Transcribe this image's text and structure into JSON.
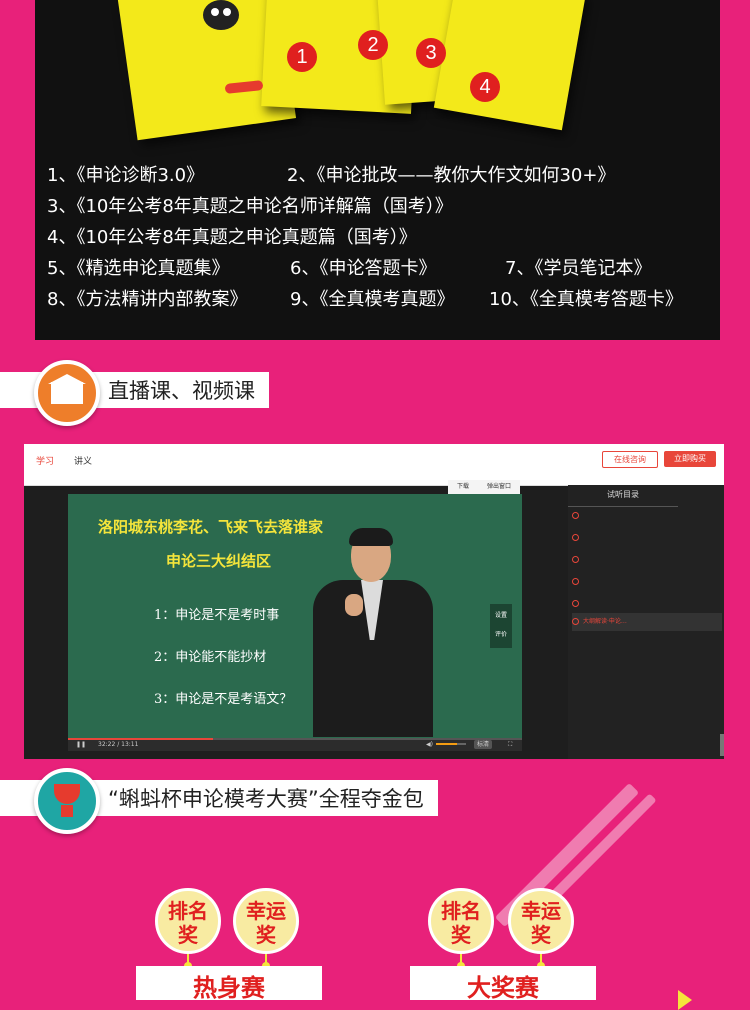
{
  "books": {
    "badges": [
      "1",
      "2",
      "3",
      "4"
    ],
    "lines": [
      [
        "1、《申论诊断3.0》",
        "2、《申论批改——教你大作文如何30+》"
      ],
      [
        "3、《10年公考8年真题之申论名师详解篇（国考）》"
      ],
      [
        "4、《10年公考8年真题之申论真题篇（国考）》"
      ],
      [
        "5、《精选申论真题集》",
        "6、《申论答题卡》",
        "7、《学员笔记本》"
      ],
      [
        "8、《方法精讲内部教案》",
        "9、《全真模考真题》",
        "10、《全真模考答题卡》"
      ]
    ]
  },
  "section_live": {
    "title": "直播课、视频课",
    "icon": "school-icon"
  },
  "player": {
    "tabs": [
      "学习",
      "讲义"
    ],
    "consult_label": "在线咨询",
    "buy_label": "立即购买",
    "mini_tools": [
      "下载",
      "弹出窗口"
    ],
    "board": {
      "title": "洛阳城东桃李花、飞来飞去落谁家",
      "subtitle": "申论三大纠结区",
      "items": [
        "1：申论是不是考时事",
        "2：申论能不能抄材",
        "3：申论是不是考语文？"
      ]
    },
    "side_tools": [
      "设置",
      "评价"
    ],
    "time": "32:22 / 13:11",
    "quality": "标清",
    "progress": 0.32,
    "volume": 0.7,
    "playlist_title": "试听目录",
    "playlist_active_label": "大纲解读·申论…"
  },
  "section_contest": {
    "title": "“蝌蚪杯申论模考大赛”全程夺金包",
    "icon": "trophy-icon"
  },
  "contest": {
    "awards": [
      "排名\n奖",
      "幸运\n奖",
      "排名\n奖",
      "幸运\n奖"
    ],
    "rounds": [
      "热身赛",
      "大奖赛"
    ]
  },
  "colors": {
    "background": "#e8217a",
    "panel": "#111111",
    "book_yellow": "#f3e91a",
    "accent_red": "#e0201f",
    "board_green": "#2b6a4e",
    "award_fill": "#f8eba2"
  }
}
